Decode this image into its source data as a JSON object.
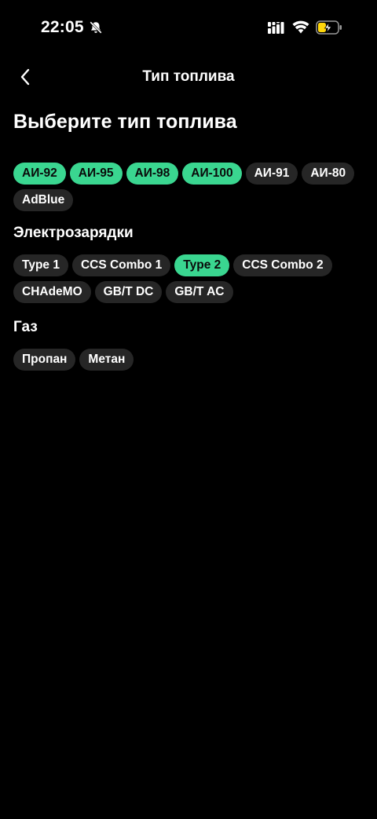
{
  "status_bar": {
    "time": "22:05",
    "icons": [
      "bell-slash-icon",
      "cellular-signal-icon",
      "wifi-icon",
      "battery-charging-icon"
    ]
  },
  "nav": {
    "title": "Тип топлива",
    "back_icon": "chevron-left-icon"
  },
  "heading": "Выберите тип топлива",
  "colors": {
    "background": "#000000",
    "chip": "#262626",
    "chip_selected": "#3ad690",
    "battery_charge": "#ffd60a"
  },
  "fuel": {
    "chips": [
      {
        "label": "АИ-92",
        "selected": true
      },
      {
        "label": "АИ-95",
        "selected": true
      },
      {
        "label": "АИ-98",
        "selected": true
      },
      {
        "label": "АИ-100",
        "selected": true
      },
      {
        "label": "АИ-91",
        "selected": false
      },
      {
        "label": "АИ-80",
        "selected": false
      },
      {
        "label": "AdBlue",
        "selected": false
      }
    ]
  },
  "electric": {
    "title": "Электрозарядки",
    "chips": [
      {
        "label": "Type 1",
        "selected": false
      },
      {
        "label": "CCS Combo 1",
        "selected": false
      },
      {
        "label": "Type 2",
        "selected": true
      },
      {
        "label": "CCS Combo 2",
        "selected": false
      },
      {
        "label": "CHAdeMO",
        "selected": false
      },
      {
        "label": "GB/T DC",
        "selected": false
      },
      {
        "label": "GB/T AC",
        "selected": false
      }
    ]
  },
  "gas": {
    "title": "Газ",
    "chips": [
      {
        "label": "Пропан",
        "selected": false
      },
      {
        "label": "Метан",
        "selected": false
      }
    ]
  }
}
